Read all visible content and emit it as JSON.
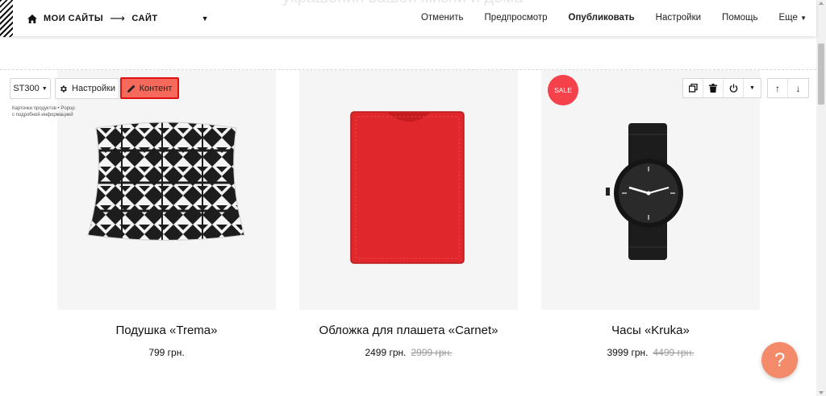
{
  "header": {
    "ghost_title": "украшения вашей жизни и дома",
    "breadcrumb_sites": "МОИ САЙТЫ",
    "breadcrumb_arrow": "⟶",
    "breadcrumb_site": "САЙТ",
    "nav": {
      "cancel": "Отменить",
      "preview": "Предпросмотр",
      "publish": "Опубликовать",
      "settings": "Настройки",
      "help": "Помощь",
      "more": "Еще"
    }
  },
  "block_toolbar": {
    "block_code": "ST300",
    "settings_label": "Настройки",
    "content_label": "Контент",
    "hint": "Карточки продуктов • Popup с подробной информацией"
  },
  "products": [
    {
      "title": "Подушка «Trema»",
      "price": "799 грн.",
      "old_price": ""
    },
    {
      "title": "Обложка для плашета «Carnet»",
      "price": "2499 грн.",
      "old_price": "2999 грн."
    },
    {
      "title": "Часы «Kruka»",
      "price": "3999 грн.",
      "old_price": "4499 грн.",
      "badge": "SALE"
    }
  ],
  "help_button": "?",
  "colors": {
    "accent": "#f56a5a",
    "sale": "#f4414a",
    "help": "#f38b6b"
  }
}
